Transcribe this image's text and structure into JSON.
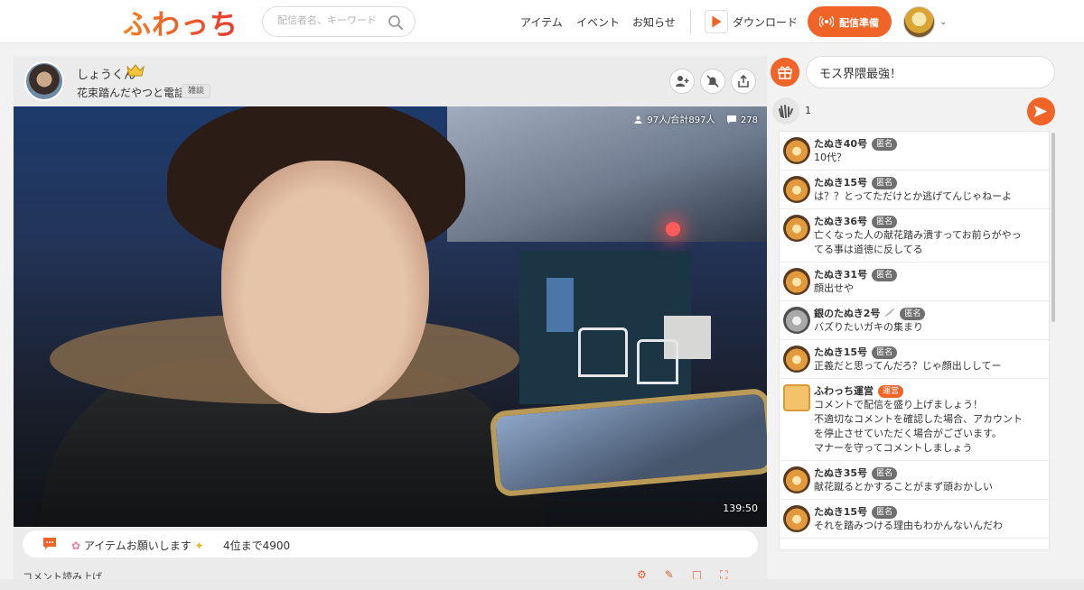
{
  "header": {
    "logo": "ふわっち",
    "search_placeholder": "配信者名、キーワード",
    "nav": [
      "アイテム",
      "イベント",
      "お知らせ"
    ],
    "download_label": "ダウンロード",
    "go_live_label": "配信準備",
    "accent_color": "#f06428"
  },
  "stream": {
    "streamer_name": "しょうくん",
    "title": "花束踏んだやつと電話",
    "category": "雑談",
    "viewers": "97人/合計897人",
    "comment_count": "278",
    "elapsed": "139:50",
    "announcement": "アイテムお願いします",
    "rank_text": "4位まで4900",
    "toolbar_peek": "コメント読み上げ"
  },
  "composer": {
    "comment_value": "モス界隈最強！",
    "clap_count": "1"
  },
  "comments": [
    {
      "name": "たぬき40号",
      "badge": "匿名",
      "text": "10代？",
      "avatar": "tanuki",
      "staff": false,
      "item": false
    },
    {
      "name": "たぬき15号",
      "badge": "匿名",
      "text": "は？？とってただけとか逃げてんじゃねーよ",
      "avatar": "tanuki",
      "staff": false,
      "item": false
    },
    {
      "name": "たぬき36号",
      "badge": "匿名",
      "text": "亡くなった人の献花踏み潰すってお前らがやっ\nてる事は道徳に反してる",
      "avatar": "tanuki",
      "staff": false,
      "item": false
    },
    {
      "name": "たぬき31号",
      "badge": "匿名",
      "text": "顔出せや",
      "avatar": "tanuki",
      "staff": false,
      "item": false
    },
    {
      "name": "銀のたぬき2号",
      "badge": "匿名",
      "text": "バズりたいガキの集まり",
      "avatar": "silver",
      "staff": false,
      "item": true
    },
    {
      "name": "たぬき15号",
      "badge": "匿名",
      "text": "正義だと思ってんだろ？じゃ顔出ししてー",
      "avatar": "tanuki",
      "staff": false,
      "item": false
    },
    {
      "name": "ふわっち運営",
      "badge": "運営",
      "text": "コメントで配信を盛り上げましょう！\n不適切なコメントを確認した場合、アカウント\nを停止させていただく場合がございます。\nマナーを守ってコメントしましょう",
      "avatar": "box",
      "staff": true,
      "item": false
    },
    {
      "name": "たぬき35号",
      "badge": "匿名",
      "text": "献花蹴るとかすることがまず頭おかしい",
      "avatar": "tanuki",
      "staff": false,
      "item": false
    },
    {
      "name": "たぬき15号",
      "badge": "匿名",
      "text": "それを踏みつける理由もわかんないんだわ",
      "avatar": "tanuki",
      "staff": false,
      "item": false
    }
  ]
}
